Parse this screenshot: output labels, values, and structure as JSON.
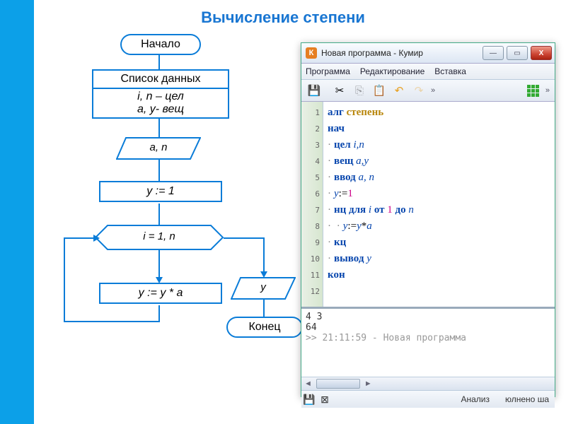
{
  "title": "Вычисление степени",
  "flow": {
    "start": "Начало",
    "data_header": "Список данных",
    "data_body1": "i, n – цел",
    "data_body2": "a, y- вещ",
    "input": "a, n",
    "init": "y := 1",
    "loop": "i = 1, n",
    "body": "y := y * a",
    "output": "y",
    "end": "Конец"
  },
  "window": {
    "icon_letter": "К",
    "title": "Новая программа - Кумир",
    "min": "—",
    "max": "▭",
    "close": "X",
    "menu": [
      "Программа",
      "Редактирование",
      "Вставка"
    ],
    "toolbar_overflow": "»",
    "code_lines": [
      {
        "n": "1",
        "t": "alg",
        "rest": " степень"
      },
      {
        "n": "2",
        "t": "nach"
      },
      {
        "n": "3",
        "t": "type_int",
        "vars": "i,n"
      },
      {
        "n": "4",
        "t": "type_real",
        "vars": "a,y"
      },
      {
        "n": "5",
        "t": "input",
        "vars": "a, n"
      },
      {
        "n": "6",
        "t": "assign_y1"
      },
      {
        "n": "7",
        "t": "loop_for"
      },
      {
        "n": "8",
        "t": "body"
      },
      {
        "n": "9",
        "t": "kc"
      },
      {
        "n": "10",
        "t": "output",
        "vars": "y"
      },
      {
        "n": "11",
        "t": "kon"
      },
      {
        "n": "12",
        "t": "blank"
      }
    ],
    "kw": {
      "alg": "алг",
      "nach": "нач",
      "int": "цел",
      "real": "вещ",
      "input": "ввод",
      "nc": "нц",
      "for": "для",
      "from": "от",
      "to": "до",
      "kc": "кц",
      "output": "вывод",
      "kon": "кон",
      "name": "степень"
    },
    "run": {
      "inputs": "4 3",
      "result": "64",
      "prompt": ">> 21:11:59 - Новая программа"
    },
    "status": {
      "analysis": "Анализ",
      "done": "юлнено ша"
    }
  }
}
